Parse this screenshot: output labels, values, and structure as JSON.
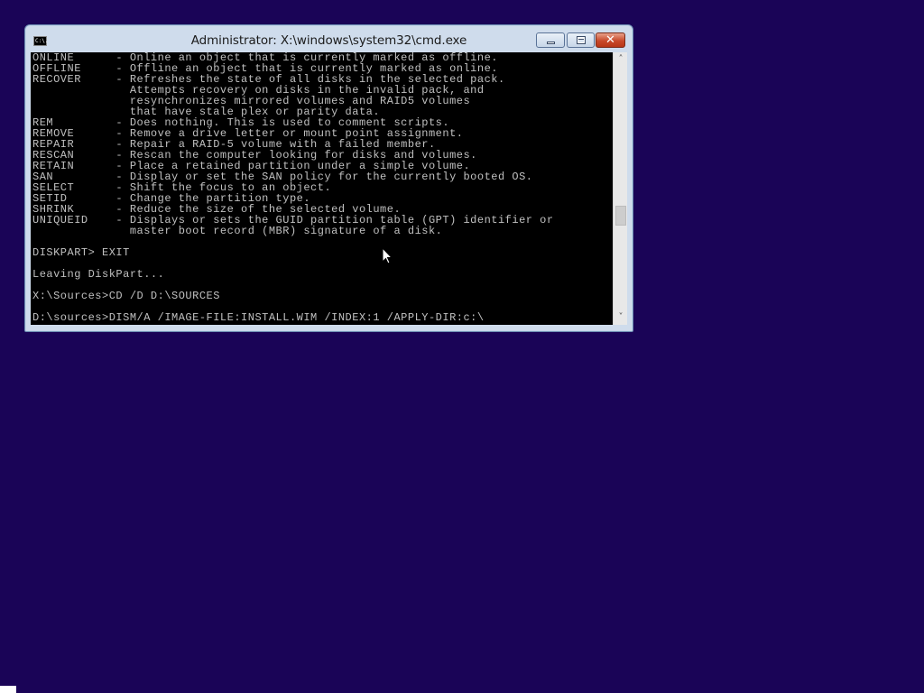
{
  "window": {
    "title": "Administrator: X:\\windows\\system32\\cmd.exe",
    "app_icon_text": "C:\\.",
    "buttons": {
      "minimize": "minimize",
      "maximize": "maximize",
      "close": "✕"
    }
  },
  "console": {
    "lines": [
      "ONLINE      - Online an object that is currently marked as offline.",
      "OFFLINE     - Offline an object that is currently marked as online.",
      "RECOVER     - Refreshes the state of all disks in the selected pack.",
      "              Attempts recovery on disks in the invalid pack, and",
      "              resynchronizes mirrored volumes and RAID5 volumes",
      "              that have stale plex or parity data.",
      "REM         - Does nothing. This is used to comment scripts.",
      "REMOVE      - Remove a drive letter or mount point assignment.",
      "REPAIR      - Repair a RAID-5 volume with a failed member.",
      "RESCAN      - Rescan the computer looking for disks and volumes.",
      "RETAIN      - Place a retained partition under a simple volume.",
      "SAN         - Display or set the SAN policy for the currently booted OS.",
      "SELECT      - Shift the focus to an object.",
      "SETID       - Change the partition type.",
      "SHRINK      - Reduce the size of the selected volume.",
      "UNIQUEID    - Displays or sets the GUID partition table (GPT) identifier or",
      "              master boot record (MBR) signature of a disk.",
      "",
      "DISKPART> EXIT",
      "",
      "Leaving DiskPart...",
      "",
      "X:\\Sources>CD /D D:\\SOURCES",
      "",
      "D:\\sources>DISM/A /IMAGE-FILE:INSTALL.WIM /INDEX:1 /APPLY-DIR:c:\\"
    ]
  },
  "scrollbar": {
    "up_arrow": "˄",
    "down_arrow": "˅",
    "thumb_position_fraction": 0.62
  },
  "colors": {
    "desktop_background": "#1a0457",
    "console_background": "#000000",
    "console_text": "#c0c0c0",
    "window_frame": "#cfdcec",
    "close_button": "#c84a2b"
  }
}
